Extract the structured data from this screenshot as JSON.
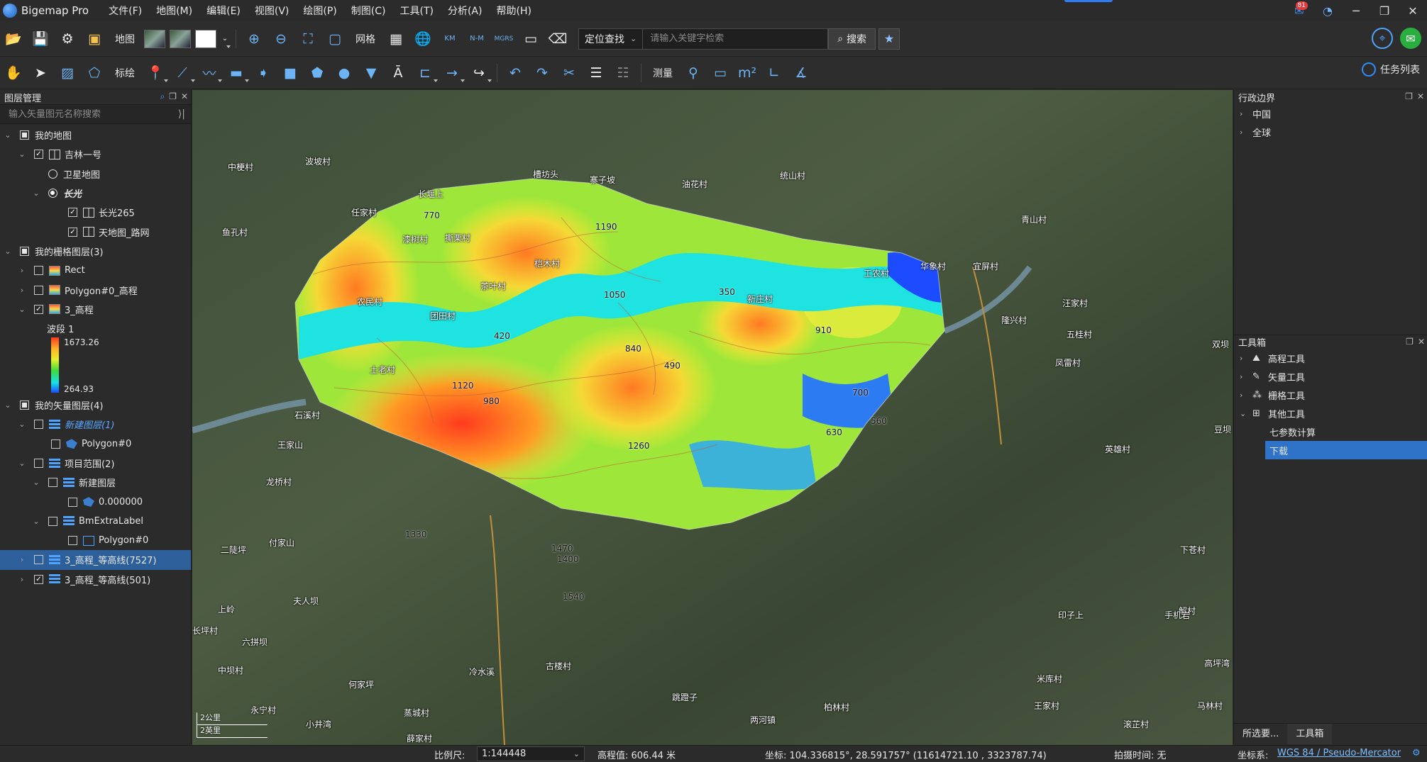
{
  "app": {
    "title": "Bigemap Pro",
    "menus": [
      "文件(F)",
      "地图(M)",
      "编辑(E)",
      "视图(V)",
      "绘图(P)",
      "制图(C)",
      "工具(T)",
      "分析(A)",
      "帮助(H)"
    ],
    "notification_count": "81"
  },
  "toolbar1": {
    "map_label": "地图",
    "grid_label": "网格",
    "search_mode": "定位查找",
    "search_placeholder": "请输入关键字检索",
    "search_button": "搜索"
  },
  "toolbar2": {
    "mark_label": "标绘",
    "measure_label": "测量",
    "tasklist_label": "任务列表"
  },
  "left_panel": {
    "title": "图层管理",
    "search_placeholder": "输入矢量图元名称搜索",
    "tree": [
      {
        "label": "我的地图"
      },
      {
        "label": "吉林一号"
      },
      {
        "label": "卫星地图"
      },
      {
        "label": "长光"
      },
      {
        "label": "长光265"
      },
      {
        "label": "天地图_路网"
      },
      {
        "label": "我的栅格图层(3)"
      },
      {
        "label": "Rect"
      },
      {
        "label": "Polygon#0_高程"
      },
      {
        "label": "3_高程"
      },
      {
        "label": "我的矢量图层(4)"
      },
      {
        "label": "新建图层(1)"
      },
      {
        "label": "Polygon#0"
      },
      {
        "label": "项目范围(2)"
      },
      {
        "label": "新建图层"
      },
      {
        "label": "0.000000"
      },
      {
        "label": "BmExtraLabel"
      },
      {
        "label": "Polygon#0"
      },
      {
        "label": "3_高程_等高线(7527)"
      },
      {
        "label": "3_高程_等高线(501)"
      }
    ],
    "legend": {
      "band": "波段 1",
      "max": "1673.26",
      "min": "264.93"
    }
  },
  "map": {
    "place_labels": [
      "中梗村",
      "波坡村",
      "槽坊头",
      "寨子坡",
      "油花村",
      "统山村",
      "鱼孔村",
      "任家村",
      "长堰上",
      "漆树村",
      "撕栗村",
      "桤木村",
      "青山村",
      "茶叶村",
      "新庄村",
      "工农村",
      "华象村",
      "宜屏村",
      "汪家村",
      "农民村",
      "团田村",
      "隆兴村",
      "五桂村",
      "土老村",
      "凤雷村",
      "石溪村",
      "龙桥村",
      "英雄村",
      "豆坝",
      "王家山",
      "付家山",
      "二陡坪",
      "下苍村",
      "夫人坝",
      "上岭",
      "解村",
      "六拼坝",
      "高坪湾",
      "永宁村",
      "印子上",
      "手机岩",
      "马林村",
      "长坪村",
      "中坝村",
      "何家坪",
      "冷水溪",
      "古楼村",
      "跳蹬子",
      "两河镇",
      "柏林村",
      "米库村",
      "王家村",
      "小井湾",
      "蒸城村",
      "滚芷村",
      "薛家村",
      "双坝"
    ],
    "contour_labels": [
      "420",
      "770",
      "1190",
      "980",
      "350",
      "1050",
      "840",
      "490",
      "630",
      "700",
      "560",
      "910",
      "1120",
      "1260",
      "1470",
      "1400",
      "1540",
      "1330"
    ],
    "scalebar_metric": "2公里",
    "scalebar_imperial": "2英里"
  },
  "right_panel": {
    "boundary_title": "行政边界",
    "boundary_items": [
      "中国",
      "全球"
    ],
    "toolbox_title": "工具箱",
    "toolbox_items": [
      "高程工具",
      "矢量工具",
      "栅格工具",
      "其他工具"
    ],
    "other_tools": [
      "七参数计算",
      "下载"
    ],
    "tabs": [
      "所选要...",
      "工具箱"
    ]
  },
  "status": {
    "scale_label": "比例尺:",
    "scale_value": "1:144448",
    "elevation": "高程值: 606.44 米",
    "coords": "坐标: 104.336815°, 28.591757°   (11614721.10 , 3323787.74)",
    "capture_time": "拍摄时间: 无",
    "crs_label": "坐标系:",
    "crs_value": "WGS 84 / Pseudo-Mercator"
  },
  "colors": {
    "accent": "#2f7cf6",
    "selection": "#2d5f9a",
    "elevation_high": "#ff3b1e",
    "elevation_low": "#1b4cff"
  }
}
